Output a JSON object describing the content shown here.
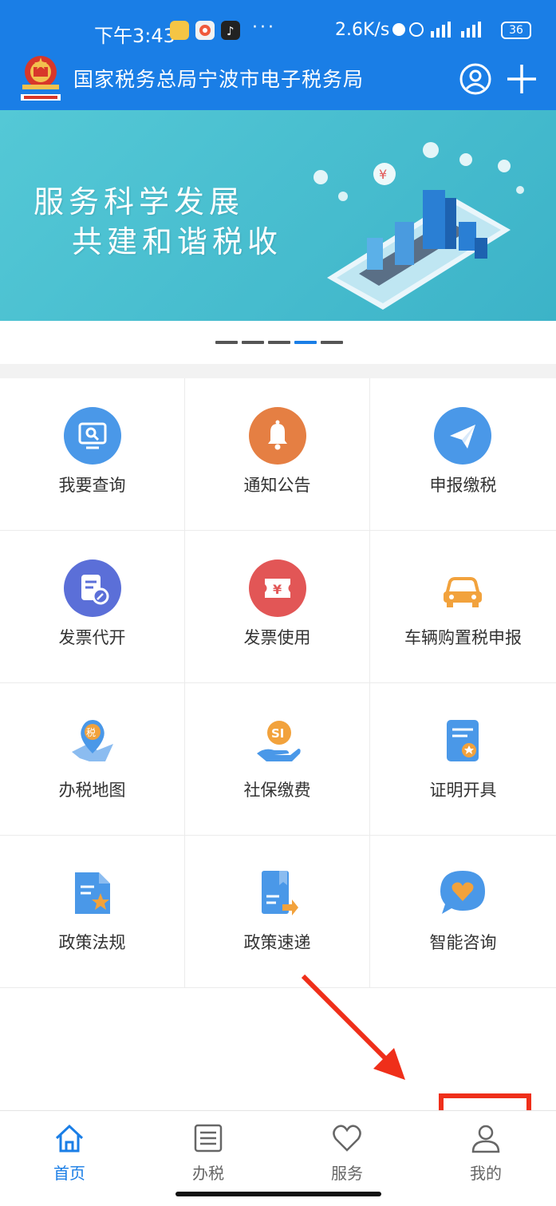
{
  "status_bar": {
    "time": "下午3:43",
    "dots": "···",
    "net_speed": "2.6K/s",
    "signal": "4G 4G",
    "battery": "36"
  },
  "app_bar": {
    "title": "国家税务总局宁波市电子税务局",
    "icons": [
      "user-icon",
      "plus-icon"
    ]
  },
  "banner": {
    "line1": "服务科学发展",
    "line2": "共建和谐税收",
    "total_slides": 5,
    "active_slide": 4
  },
  "grid": [
    {
      "label": "我要查询",
      "icon": "query-icon",
      "color": "#4a98e8"
    },
    {
      "label": "通知公告",
      "icon": "bell-icon",
      "color": "#e57f43"
    },
    {
      "label": "申报缴税",
      "icon": "paper-plane-icon",
      "color": "#4a98e8"
    },
    {
      "label": "发票代开",
      "icon": "invoice-edit-icon",
      "color": "#5b6fd8"
    },
    {
      "label": "发票使用",
      "icon": "ticket-yuan-icon",
      "color": "#e25656"
    },
    {
      "label": "车辆购置税申报",
      "icon": "car-icon",
      "color": "#f2a23c"
    },
    {
      "label": "办税地图",
      "icon": "tax-map-icon",
      "color": "#4a98e8"
    },
    {
      "label": "社保缴费",
      "icon": "social-security-icon",
      "color": "#f2a23c"
    },
    {
      "label": "证明开具",
      "icon": "certificate-icon",
      "color": "#4a98e8"
    },
    {
      "label": "政策法规",
      "icon": "policy-doc-icon",
      "color": "#4a98e8"
    },
    {
      "label": "政策速递",
      "icon": "policy-express-icon",
      "color": "#4a98e8"
    },
    {
      "label": "智能咨询",
      "icon": "chat-heart-icon",
      "color": "#4a98e8"
    }
  ],
  "tabs": [
    {
      "label": "首页",
      "icon": "home-icon",
      "active": true
    },
    {
      "label": "办税",
      "icon": "list-icon",
      "active": false
    },
    {
      "label": "服务",
      "icon": "heart-icon",
      "active": false
    },
    {
      "label": "我的",
      "icon": "person-icon",
      "active": false
    }
  ],
  "colors": {
    "primary": "#1a7ee6",
    "annotation": "#ef2f1a"
  }
}
